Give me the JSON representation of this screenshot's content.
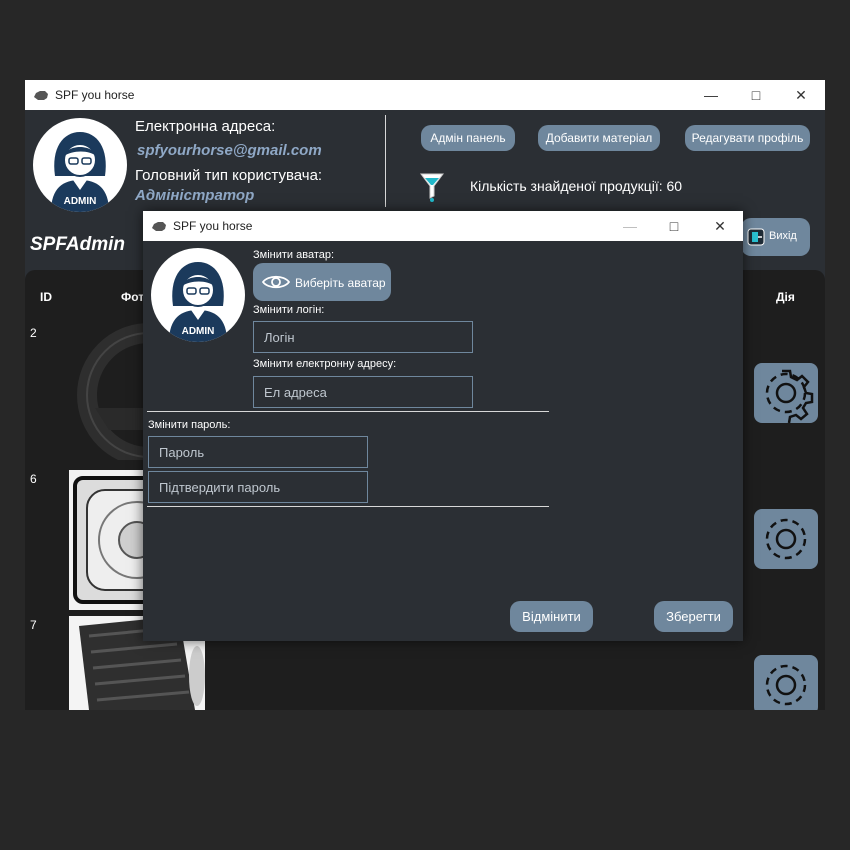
{
  "window": {
    "title": "SPF you horse"
  },
  "header": {
    "email_label": "Електронна адреса:",
    "email_value": "spfyourhorse@gmail.com",
    "user_type_label": "Головний тип користувача:",
    "user_type_value": "Адміністратор",
    "avatar_text": "ADMIN",
    "username": "SPFAdmin",
    "admin_panel_btn": "Адмін панель",
    "add_material_btn": "Добавити матеріал",
    "edit_profile_btn": "Редагувати профіль",
    "products_found": "Кількість знайденої продукції: 60",
    "exit_btn": "Вихід"
  },
  "table": {
    "headers": {
      "id": "ID",
      "photo": "Фот",
      "action": "Дія"
    },
    "rows": [
      {
        "id": "2"
      },
      {
        "id": "6"
      },
      {
        "id": "7"
      }
    ]
  },
  "dialog": {
    "title": "SPF you horse",
    "avatar_text": "ADMIN",
    "change_avatar_label": "Змінити аватар:",
    "choose_avatar_btn": "Виберіть аватар",
    "change_login_label": "Змінити логін:",
    "login_placeholder": "Логін",
    "change_email_label": "Змінити електронну адресу:",
    "email_placeholder": "Ел адреса",
    "change_password_label": "Змінити пароль:",
    "password_placeholder": "Пароль",
    "confirm_password_placeholder": "Підтвердити пароль",
    "cancel_btn": "Відмінити",
    "save_btn": "Зберегти"
  },
  "colors": {
    "accent": "#6f879d",
    "panel": "#2b2f34",
    "table_bg": "#1e1e1e",
    "email_blue": "#8fa8c6",
    "avatar_navy": "#1b3a5c"
  }
}
